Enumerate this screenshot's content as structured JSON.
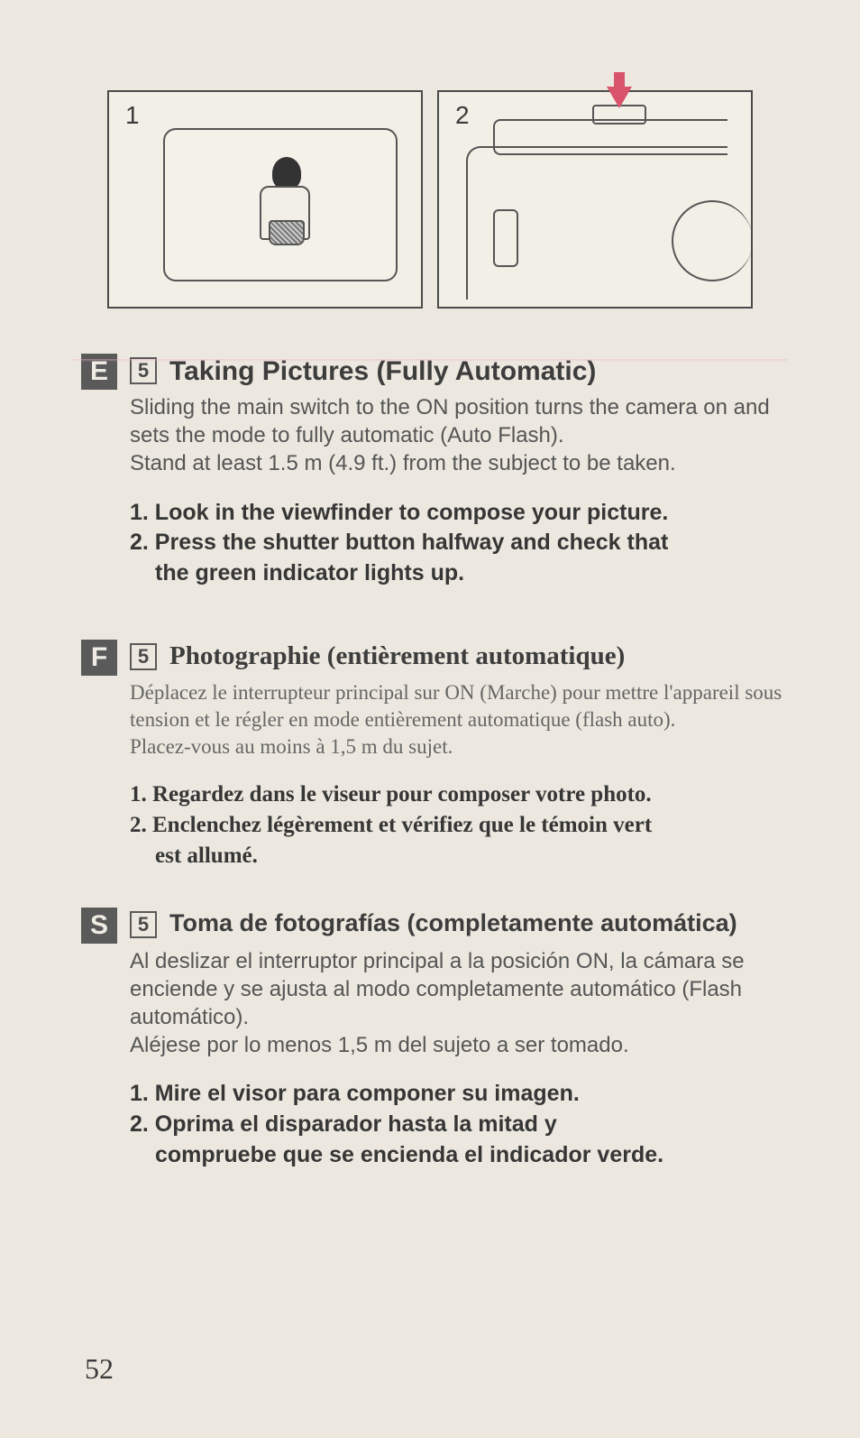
{
  "figures": {
    "fig1_number": "1",
    "fig2_number": "2"
  },
  "sections": [
    {
      "lang_badge": "E",
      "chapter": "5",
      "title": "Taking Pictures (Fully Automatic)",
      "body_lines": [
        "Sliding the main switch to the ON position turns the camera on and sets the mode to fully automatic (Auto Flash).",
        "Stand at least 1.5 m (4.9 ft.) from the subject to be taken."
      ],
      "steps": [
        "1. Look in the viewfinder to compose your picture.",
        "2. Press the shutter button halfway and check that",
        "the green indicator lights up."
      ],
      "style": "sans"
    },
    {
      "lang_badge": "F",
      "chapter": "5",
      "title": "Photographie (entièrement automatique)",
      "body_lines": [
        "Déplacez le interrupteur principal sur ON (Marche) pour mettre l'appareil sous tension et le régler en mode entièrement automatique (flash auto).",
        "Placez-vous au moins à 1,5 m du sujet."
      ],
      "steps": [
        "1. Regardez dans le viseur pour composer votre photo.",
        "2. Enclenchez légèrement et vérifiez que le témoin vert",
        "est allumé."
      ],
      "style": "serif"
    },
    {
      "lang_badge": "S",
      "chapter": "5",
      "title": "Toma de fotografías (completamente automática)",
      "body_lines": [
        "Al deslizar el interruptor principal a la posición ON, la cámara se enciende y se ajusta al modo completamente automático (Flash automático).",
        "Aléjese por lo menos 1,5 m del sujeto a ser tomado."
      ],
      "steps": [
        "1. Mire el visor para componer su imagen.",
        "2. Oprima el disparador hasta la mitad y",
        "compruebe que se encienda el indicador verde."
      ],
      "style": "sans"
    }
  ],
  "page_number": "52"
}
